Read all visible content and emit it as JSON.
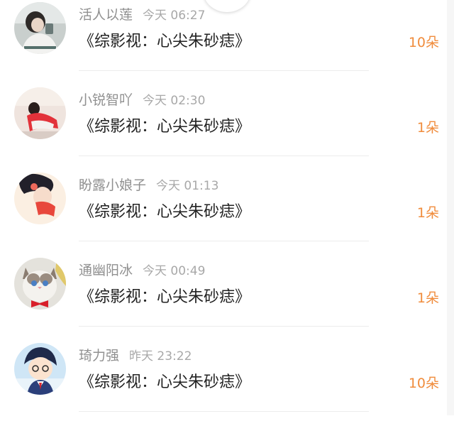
{
  "gift_list": {
    "items": [
      {
        "username": "活人以莲",
        "time": "今天 06:27",
        "title": "《综影视：心尖朱砂痣》",
        "count": "10朵",
        "avatar": "girl-with-cup-avatar"
      },
      {
        "username": "小锐智吖",
        "time": "今天 02:30",
        "title": "《综影视：心尖朱砂痣》",
        "count": "1朵",
        "avatar": "girl-in-red-avatar"
      },
      {
        "username": "盼露小娘子",
        "time": "今天 01:13",
        "title": "《综影视：心尖朱砂痣》",
        "count": "1朵",
        "avatar": "illustrated-girl-avatar"
      },
      {
        "username": "通幽阳冰",
        "time": "今天 00:49",
        "title": "《综影视：心尖朱砂痣》",
        "count": "1朵",
        "avatar": "cat-with-bowtie-avatar"
      },
      {
        "username": "琦力强",
        "time": "昨天 23:22",
        "title": "《综影视：心尖朱砂痣》",
        "count": "10朵",
        "avatar": "anime-boy-avatar"
      }
    ]
  },
  "colors": {
    "accent": "#f08c3c",
    "username": "#909090",
    "time": "#a8a8a8",
    "title": "#222222"
  }
}
